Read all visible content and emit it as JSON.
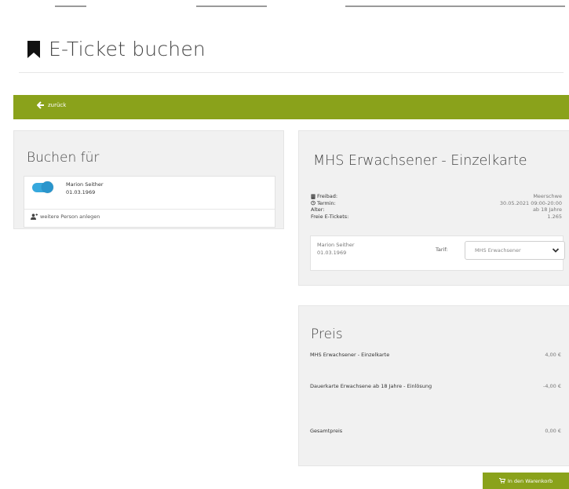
{
  "page": {
    "title": "E-Ticket buchen"
  },
  "nav": {
    "back_label": "zurück"
  },
  "booking_for": {
    "heading": "Buchen für",
    "person": {
      "name": "Marion Seither",
      "dob": "01.03.1969",
      "selected": true
    },
    "add_person_label": "weitere Person anlegen"
  },
  "ticket": {
    "title": "MHS Erwachsener - Einzelkarte",
    "rows": [
      {
        "label": "Freibad:",
        "value": "Meerschwe",
        "icon": "building-icon"
      },
      {
        "label": "Termin:",
        "value": "30.05.2021 09:00-20:00",
        "icon": "clock-icon"
      },
      {
        "label": "Alter:",
        "value": "ab 18 Jahre",
        "icon": ""
      },
      {
        "label": "Freie E-Tickets:",
        "value": "1.265",
        "icon": ""
      }
    ],
    "tariff": {
      "person_name": "Marion Seither",
      "person_dob": "01.03.1969",
      "label": "Tarif:",
      "selected": "MHS Erwachsener"
    }
  },
  "price": {
    "heading": "Preis",
    "items": [
      {
        "label": "MHS Erwachsener - Einzelkarte",
        "amount": "4,00 €"
      },
      {
        "label": "Dauerkarte Erwachsene ab 18 Jahre - Einlösung",
        "amount": "-4,00 €"
      }
    ],
    "total_label": "Gesamtpreis",
    "total_amount": "0,00 €"
  },
  "actions": {
    "cart_label": "In den Warenkorb"
  },
  "colors": {
    "accent_green": "#8aa21b",
    "toggle_blue": "#36a8dd",
    "panel_bg": "#f1f1f1"
  }
}
